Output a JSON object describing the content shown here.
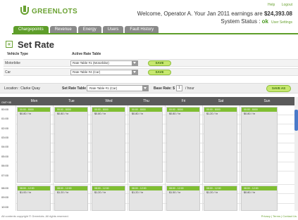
{
  "brand": {
    "name": "GREENLOTS"
  },
  "header": {
    "links": [
      "Help",
      "Logout"
    ],
    "welcome_prefix": "Welcome, Operator A. Your Jan 2011 earnings are ",
    "earnings": "$24,393.08",
    "status_label": "System Status : ",
    "status_value": "ok",
    "user_settings": "User Settings"
  },
  "nav": {
    "tabs": [
      {
        "label": "Chargepoints",
        "active": true
      },
      {
        "label": "Revenue",
        "active": false
      },
      {
        "label": "Energy",
        "active": false
      },
      {
        "label": "Users",
        "active": false
      },
      {
        "label": "Fault History",
        "active": false
      }
    ]
  },
  "page": {
    "title": "Set Rate",
    "back_icon": "double-chevron-left-icon"
  },
  "rate_table": {
    "col_vehicle": "Vehicle Type",
    "col_active": "Active Rate Table",
    "rows": [
      {
        "vehicle": "Motorbike",
        "table": "Rate Table #1 (Motorbike)",
        "save": "SAVE"
      },
      {
        "vehicle": "Car",
        "table": "Rate Table #4 (Car)",
        "save": "SAVE"
      }
    ]
  },
  "location_bar": {
    "location_label": "Location :",
    "location_value": "Clarke Quay",
    "set_rate_label": "Set Rate Table",
    "set_rate_value": "Rate Table #1 (Car)",
    "base_rate_label": "Base Rate: $",
    "base_rate_value": "1",
    "base_rate_unit": "/ hour",
    "save_as": "SAVE AS"
  },
  "calendar": {
    "timezone": "GMT+08",
    "days": [
      "Mon",
      "Tue",
      "Wed",
      "Thu",
      "Fri",
      "Sat",
      "Sun"
    ],
    "hours": [
      "00:00",
      "01:00",
      "02:00",
      "03:00",
      "04:00",
      "05:00",
      "06:00",
      "07:00",
      "08:00",
      "09:00",
      "10:00"
    ],
    "morning_blocks": [
      {
        "time": "00:00 - 8000",
        "rate": "$0.80 / hr"
      },
      {
        "time": "00:00 - 8000",
        "rate": "$0.80 / hr"
      },
      {
        "time": "00:00 - 8000",
        "rate": "$0.80 / hr"
      },
      {
        "time": "00:00 - 8000",
        "rate": "$0.80 / hr"
      },
      {
        "time": "00:00 - 8000",
        "rate": "$0.80 / hr"
      },
      {
        "time": "00:00 - 8000",
        "rate": "$1.20 / hr"
      },
      {
        "time": "00:00 - 8000",
        "rate": "$0.80 / hr"
      }
    ],
    "day_blocks": [
      {
        "time": "08:00 - 12:00",
        "rate": "$1.00 / hr"
      },
      {
        "time": "08:00 - 12:00",
        "rate": "$1.20 / hr"
      },
      {
        "time": "08:00 - 12:00",
        "rate": "$1.20 / hr"
      },
      {
        "time": "08:00 - 12:00",
        "rate": "$1.20 / hr"
      },
      {
        "time": "08:00 - 12:00",
        "rate": "$1.50 / hr"
      },
      {
        "time": "08:00 - 12:00",
        "rate": "$1.20 / hr"
      },
      {
        "time": "08:00 - 12:00",
        "rate": "$0.80 / hr"
      }
    ]
  },
  "footer": {
    "copyright": "All contents copyright © Greenlots. All rights reserved.",
    "links": "Privacy | Terms | Contact Us"
  }
}
